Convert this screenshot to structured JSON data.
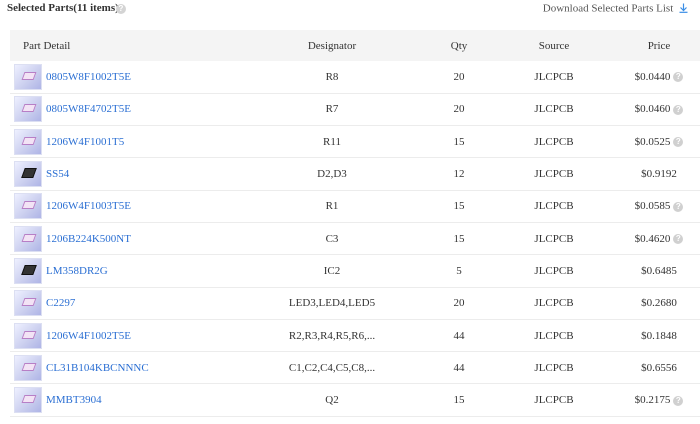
{
  "header": {
    "title": "Selected Parts(11 items)",
    "help_symbol": "?",
    "download_label": "Download Selected Parts List"
  },
  "columns": {
    "part": "Part Detail",
    "designator": "Designator",
    "qty": "Qty",
    "source": "Source",
    "price": "Price"
  },
  "rows": [
    {
      "part": "0805W8F1002T5E",
      "designator": "R8",
      "qty": "20",
      "source": "JLCPCB",
      "price": "$0.0440",
      "price_help": "?",
      "chip": "pink"
    },
    {
      "part": "0805W8F4702T5E",
      "designator": "R7",
      "qty": "20",
      "source": "JLCPCB",
      "price": "$0.0460",
      "price_help": "?",
      "chip": "pink"
    },
    {
      "part": "1206W4F1001T5",
      "designator": "R11",
      "qty": "15",
      "source": "JLCPCB",
      "price": "$0.0525",
      "price_help": "?",
      "chip": "pink"
    },
    {
      "part": "SS54",
      "designator": "D2,D3",
      "qty": "12",
      "source": "JLCPCB",
      "price": "$0.9192",
      "price_help": "",
      "chip": "dark"
    },
    {
      "part": "1206W4F1003T5E",
      "designator": "R1",
      "qty": "15",
      "source": "JLCPCB",
      "price": "$0.0585",
      "price_help": "?",
      "chip": "pink"
    },
    {
      "part": "1206B224K500NT",
      "designator": "C3",
      "qty": "15",
      "source": "JLCPCB",
      "price": "$0.4620",
      "price_help": "?",
      "chip": "pink"
    },
    {
      "part": "LM358DR2G",
      "designator": "IC2",
      "qty": "5",
      "source": "JLCPCB",
      "price": "$0.6485",
      "price_help": "",
      "chip": "dark"
    },
    {
      "part": "C2297",
      "designator": "LED3,LED4,LED5",
      "qty": "20",
      "source": "JLCPCB",
      "price": "$0.2680",
      "price_help": "",
      "chip": "pink"
    },
    {
      "part": "1206W4F1002T5E",
      "designator": "R2,R3,R4,R5,R6,...",
      "qty": "44",
      "source": "JLCPCB",
      "price": "$0.1848",
      "price_help": "",
      "chip": "pink"
    },
    {
      "part": "CL31B104KBCNNNC",
      "designator": "C1,C2,C4,C5,C8,...",
      "qty": "44",
      "source": "JLCPCB",
      "price": "$0.6556",
      "price_help": "",
      "chip": "pink"
    },
    {
      "part": "MMBT3904",
      "designator": "Q2",
      "qty": "15",
      "source": "JLCPCB",
      "price": "$0.2175",
      "price_help": "?",
      "chip": "pink"
    }
  ],
  "colors": {
    "link": "#2b6fd3",
    "header_bg": "#f4f4f4",
    "download_icon": "#3a8ee6"
  }
}
